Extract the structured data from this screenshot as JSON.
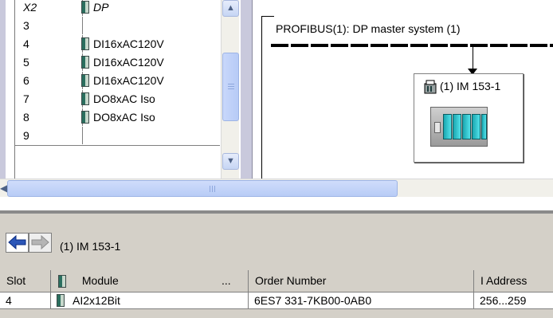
{
  "rack": {
    "rows": [
      {
        "slot": "X2",
        "module": "DP",
        "has_icon": true,
        "italic": true
      },
      {
        "slot": "3",
        "module": "",
        "has_icon": false
      },
      {
        "slot": "4",
        "module": "DI16xAC120V",
        "has_icon": true
      },
      {
        "slot": "5",
        "module": "DI16xAC120V",
        "has_icon": true
      },
      {
        "slot": "6",
        "module": "DI16xAC120V",
        "has_icon": true
      },
      {
        "slot": "7",
        "module": "DO8xAC Iso",
        "has_icon": true
      },
      {
        "slot": "8",
        "module": "DO8xAC Iso",
        "has_icon": true
      },
      {
        "slot": "9",
        "module": "",
        "has_icon": false
      }
    ]
  },
  "network": {
    "bus_label": "PROFIBUS(1): DP master system (1)",
    "station_label": "(1) IM 153-1"
  },
  "detail": {
    "module_path": "(1)  IM 153-1",
    "columns": {
      "slot": "Slot",
      "module": "Module",
      "more": "...",
      "order_number": "Order Number",
      "i_address": "I Address"
    },
    "rows": [
      {
        "slot": "4",
        "module": "AI2x12Bit",
        "order_number": "6ES7 331-7KB00-0AB0",
        "i_address": "256...259"
      }
    ]
  },
  "icons": {
    "nav_back": "arrow-left-icon",
    "nav_forward": "arrow-right-icon",
    "module_chip": "module-icon",
    "station": "station-icon"
  },
  "colors": {
    "scroll_accent": "#b7cbf6",
    "panel_bg": "#d4d0c8",
    "nav_arrow": "#2b56b8",
    "device_slot": "#1aa7b0"
  }
}
